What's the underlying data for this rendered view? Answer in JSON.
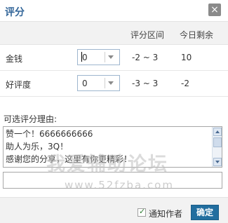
{
  "dialog": {
    "title": "评分",
    "close_glyph": "×"
  },
  "table": {
    "headers": {
      "range": "评分区间",
      "remaining": "今日剩余"
    },
    "rows": [
      {
        "label": "金钱",
        "selected": "0",
        "range": "-2 ~ 3",
        "remaining": "10"
      },
      {
        "label": "好评度",
        "selected": "0",
        "range": "-3 ~ 3",
        "remaining": "-2"
      }
    ]
  },
  "reason": {
    "label": "可选评分理由:",
    "options": [
      "赞一个！6666666666",
      "助人为乐，3Q！",
      "感谢您的分享，这里有你更精彩！"
    ],
    "custom_value": ""
  },
  "watermark": {
    "text": "我爱辅助论坛",
    "url": "www.52fzba.com"
  },
  "footer": {
    "notify_label": "通知作者",
    "notify_checked": true,
    "confirm_label": "确定"
  },
  "colors": {
    "title": "#336699",
    "confirm_bg": "#226e9f",
    "header_bg": "#f2f2f2"
  }
}
